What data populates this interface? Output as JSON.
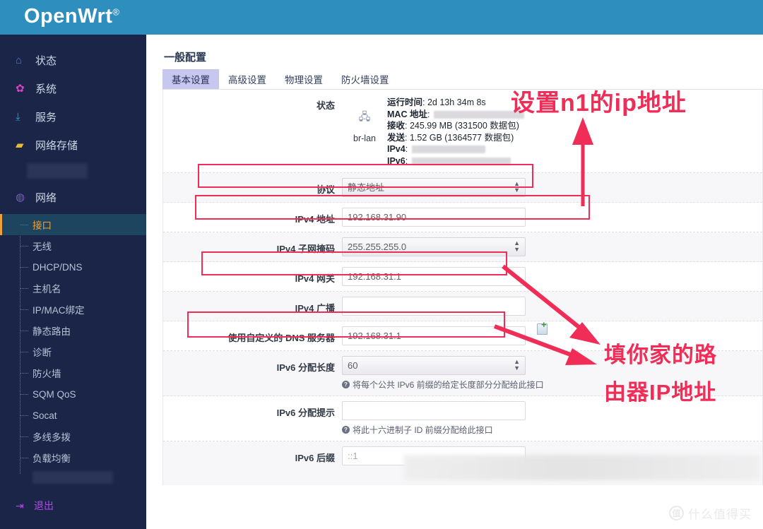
{
  "header": {
    "brand": "OpenWrt",
    "brand_sup": "®",
    "bg": "#2e8fbe"
  },
  "sidebar": {
    "bg": "#1a2547",
    "top_items": [
      {
        "label": "状态",
        "icon": "home-icon",
        "glyph": "⌂"
      },
      {
        "label": "系统",
        "icon": "gear-icon",
        "glyph": "✿"
      },
      {
        "label": "服务",
        "icon": "download-icon",
        "glyph": "⤓"
      },
      {
        "label": "网络存储",
        "icon": "storage-icon",
        "glyph": "▰"
      }
    ],
    "redacted_item": "",
    "network_item": {
      "label": "网络",
      "icon": "globe-icon",
      "glyph": "◍"
    },
    "sub_items": [
      {
        "label": "接口",
        "active": true
      },
      {
        "label": "无线",
        "active": false
      },
      {
        "label": "DHCP/DNS",
        "active": false
      },
      {
        "label": "主机名",
        "active": false
      },
      {
        "label": "IP/MAC绑定",
        "active": false
      },
      {
        "label": "静态路由",
        "active": false
      },
      {
        "label": "诊断",
        "active": false
      },
      {
        "label": "防火墙",
        "active": false
      },
      {
        "label": "SQM QoS",
        "active": false
      },
      {
        "label": "Socat",
        "active": false
      },
      {
        "label": "多线多拨",
        "active": false
      },
      {
        "label": "负载均衡",
        "active": false
      }
    ],
    "logout": {
      "label": "退出",
      "icon": "logout-icon",
      "glyph": "⇥"
    }
  },
  "main": {
    "page_title": "一般配置",
    "tabs": [
      {
        "label": "基本设置",
        "active": true
      },
      {
        "label": "高级设置",
        "active": false
      },
      {
        "label": "物理设置",
        "active": false
      },
      {
        "label": "防火墙设置",
        "active": false
      }
    ],
    "status": {
      "label": "状态",
      "iface_name": "br-lan",
      "iface_icon": "ethernet-icon",
      "uptime_label": "运行时间",
      "uptime_value": "2d 13h 34m 8s",
      "mac_label": "MAC 地址",
      "mac_value": "",
      "rx_label": "接收",
      "rx_value": "245.99 MB (331500 数据包)",
      "tx_label": "发送",
      "tx_value": "1.52 GB (1364577 数据包)",
      "ipv4_label": "IPv4",
      "ipv4_value": "",
      "ipv6_label": "IPv6",
      "ipv6_value": ""
    },
    "fields": [
      {
        "label": "协议",
        "type": "select",
        "value": "静态地址",
        "highlighted": true
      },
      {
        "label": "IPv4 地址",
        "type": "text",
        "value": "192.168.31.90",
        "highlighted": true
      },
      {
        "label": "IPv4 子网掩码",
        "type": "select",
        "value": "255.255.255.0",
        "highlighted": false
      },
      {
        "label": "IPv4 网关",
        "type": "text",
        "value": "192.168.31.1",
        "highlighted": true
      },
      {
        "label": "IPv4 广播",
        "type": "text",
        "value": "",
        "highlighted": false
      },
      {
        "label": "使用自定义的 DNS 服务器",
        "type": "text-add",
        "value": "192.168.31.1",
        "highlighted": true
      },
      {
        "label": "IPv6 分配长度",
        "type": "select",
        "value": "60",
        "highlighted": false,
        "hint": "将每个公共 IPv6 前缀的给定长度部分分配给此接口"
      },
      {
        "label": "IPv6 分配提示",
        "type": "text",
        "value": "",
        "highlighted": false,
        "hint": "将此十六进制子 ID 前缀分配给此接口"
      },
      {
        "label": "IPv6 后缀",
        "type": "text",
        "value": "::1",
        "highlighted": false
      }
    ]
  },
  "annotations": {
    "color": "#ef2d56",
    "top_text": "设置n1的ip地址",
    "bottom_line1": "填你家的路",
    "bottom_line2": "由器IP地址"
  },
  "watermark": {
    "mark": "值",
    "text": "什么值得买"
  }
}
